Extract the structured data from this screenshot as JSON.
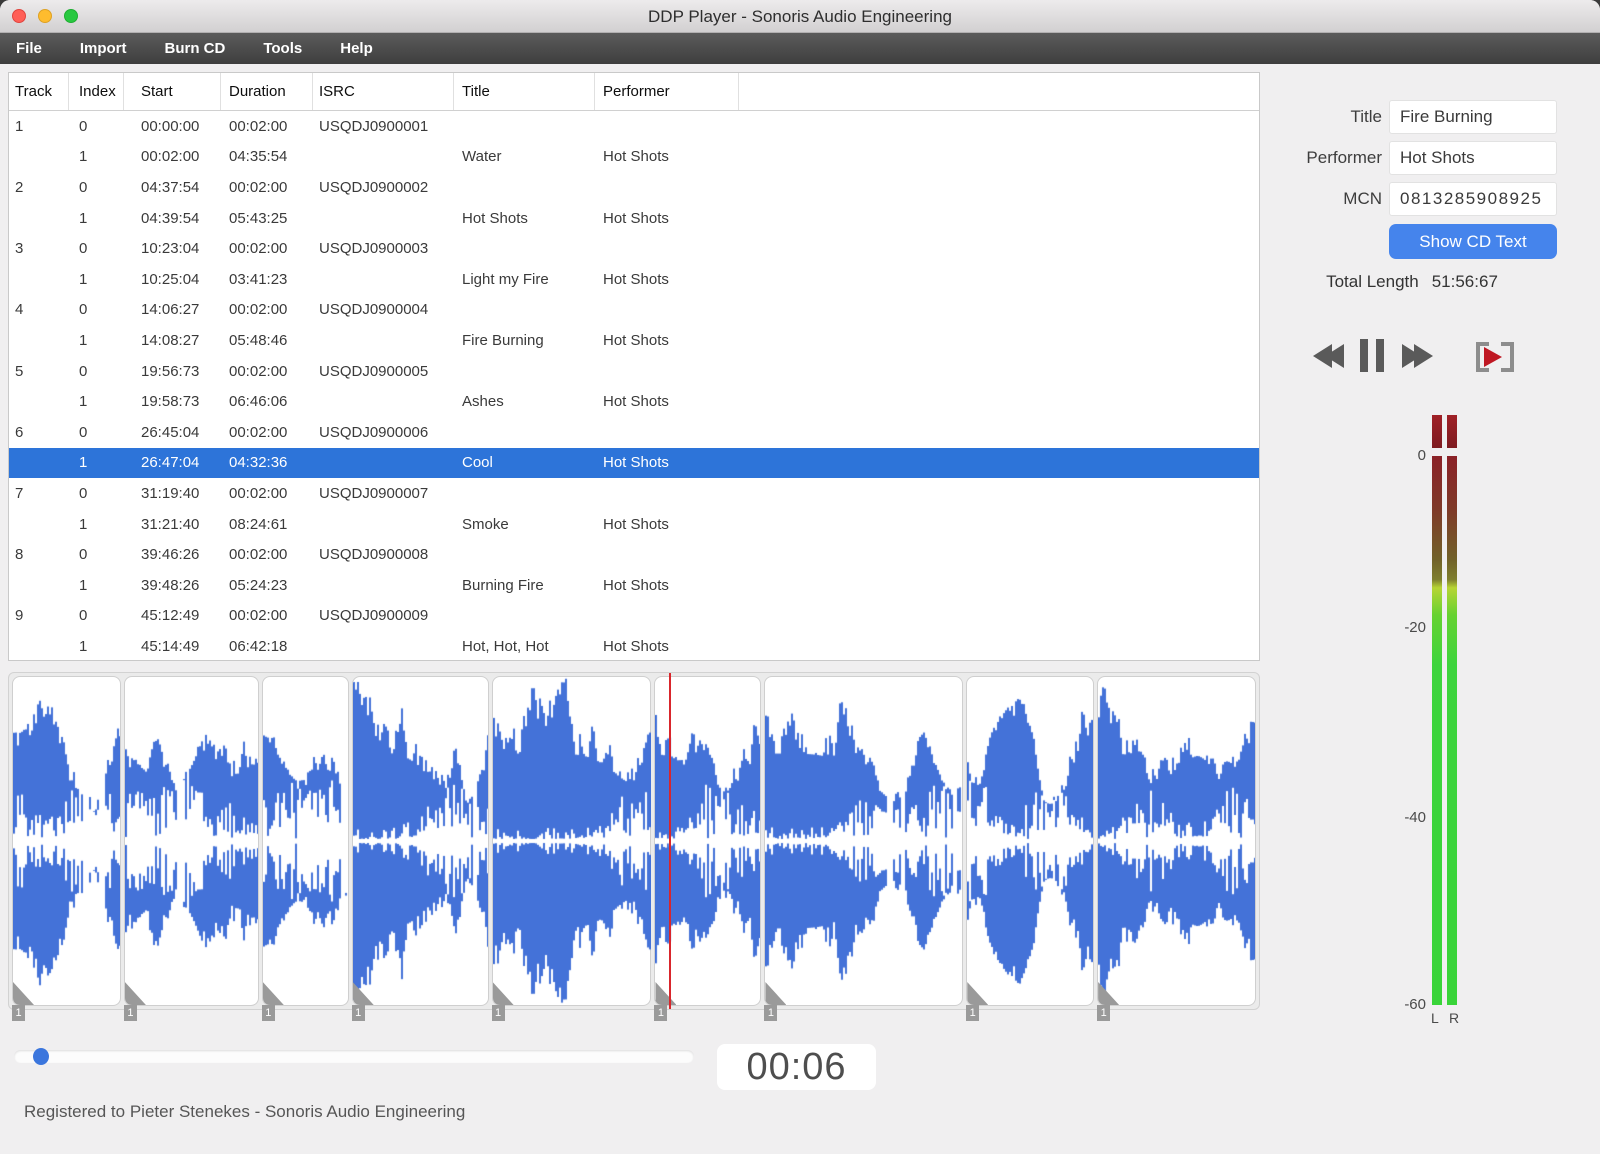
{
  "window": {
    "title": "DDP Player - Sonoris Audio Engineering"
  },
  "menu": {
    "items": [
      "File",
      "Import",
      "Burn CD",
      "Tools",
      "Help"
    ]
  },
  "table": {
    "columns": [
      "Track",
      "Index",
      "Start",
      "Duration",
      "ISRC",
      "Title",
      "Performer"
    ],
    "selected_index": 11,
    "rows": [
      {
        "track": "1",
        "index": "0",
        "start": "00:00:00",
        "duration": "00:02:00",
        "isrc": "USQDJ0900001",
        "title": "",
        "performer": ""
      },
      {
        "track": "",
        "index": "1",
        "start": "00:02:00",
        "duration": "04:35:54",
        "isrc": "",
        "title": "Water",
        "performer": "Hot Shots"
      },
      {
        "track": "2",
        "index": "0",
        "start": "04:37:54",
        "duration": "00:02:00",
        "isrc": "USQDJ0900002",
        "title": "",
        "performer": ""
      },
      {
        "track": "",
        "index": "1",
        "start": "04:39:54",
        "duration": "05:43:25",
        "isrc": "",
        "title": "Hot Shots",
        "performer": "Hot Shots"
      },
      {
        "track": "3",
        "index": "0",
        "start": "10:23:04",
        "duration": "00:02:00",
        "isrc": "USQDJ0900003",
        "title": "",
        "performer": ""
      },
      {
        "track": "",
        "index": "1",
        "start": "10:25:04",
        "duration": "03:41:23",
        "isrc": "",
        "title": "Light my Fire",
        "performer": "Hot Shots"
      },
      {
        "track": "4",
        "index": "0",
        "start": "14:06:27",
        "duration": "00:02:00",
        "isrc": "USQDJ0900004",
        "title": "",
        "performer": ""
      },
      {
        "track": "",
        "index": "1",
        "start": "14:08:27",
        "duration": "05:48:46",
        "isrc": "",
        "title": "Fire Burning",
        "performer": "Hot Shots"
      },
      {
        "track": "5",
        "index": "0",
        "start": "19:56:73",
        "duration": "00:02:00",
        "isrc": "USQDJ0900005",
        "title": "",
        "performer": ""
      },
      {
        "track": "",
        "index": "1",
        "start": "19:58:73",
        "duration": "06:46:06",
        "isrc": "",
        "title": "Ashes",
        "performer": "Hot Shots"
      },
      {
        "track": "6",
        "index": "0",
        "start": "26:45:04",
        "duration": "00:02:00",
        "isrc": "USQDJ0900006",
        "title": "",
        "performer": ""
      },
      {
        "track": "",
        "index": "1",
        "start": "26:47:04",
        "duration": "04:32:36",
        "isrc": "",
        "title": "Cool",
        "performer": "Hot Shots"
      },
      {
        "track": "7",
        "index": "0",
        "start": "31:19:40",
        "duration": "00:02:00",
        "isrc": "USQDJ0900007",
        "title": "",
        "performer": ""
      },
      {
        "track": "",
        "index": "1",
        "start": "31:21:40",
        "duration": "08:24:61",
        "isrc": "",
        "title": "Smoke",
        "performer": "Hot Shots"
      },
      {
        "track": "8",
        "index": "0",
        "start": "39:46:26",
        "duration": "00:02:00",
        "isrc": "USQDJ0900008",
        "title": "",
        "performer": ""
      },
      {
        "track": "",
        "index": "1",
        "start": "39:48:26",
        "duration": "05:24:23",
        "isrc": "",
        "title": "Burning Fire",
        "performer": "Hot Shots"
      },
      {
        "track": "9",
        "index": "0",
        "start": "45:12:49",
        "duration": "00:02:00",
        "isrc": "USQDJ0900009",
        "title": "",
        "performer": ""
      },
      {
        "track": "",
        "index": "1",
        "start": "45:14:49",
        "duration": "06:42:18",
        "isrc": "",
        "title": "Hot, Hot, Hot",
        "performer": "Hot Shots"
      }
    ]
  },
  "side_panel": {
    "title_label": "Title",
    "title_value": "Fire Burning",
    "performer_label": "Performer",
    "performer_value": "Hot Shots",
    "mcn_label": "MCN",
    "mcn_value": "0813285908925",
    "show_cd_text_label": "Show CD Text",
    "total_length_label": "Total Length",
    "total_length_value": "51:56:67"
  },
  "transport": {
    "icons": [
      "rewind-icon",
      "pause-icon",
      "fast-forward-icon",
      "pq-play-icon"
    ]
  },
  "meter": {
    "ticks": [
      "0",
      "-20",
      "-40",
      "-60"
    ],
    "channels": [
      "L",
      "R"
    ]
  },
  "waveform": {
    "marker_label": "1",
    "playhead_fraction": 0.527
  },
  "timeline": {
    "time_display": "00:06",
    "slider_fraction": 0.04
  },
  "status_bar": {
    "text": "Registered to Pieter Stenekes - Sonoris Audio Engineering"
  },
  "colors": {
    "selection_blue": "#2d74d9",
    "waveform_blue": "#4472d8",
    "button_blue": "#4584ec",
    "playhead_red": "#d9262c",
    "meter_green": "#3cd43c",
    "meter_yellow": "#b5d334",
    "meter_dark_red": "#8b2127",
    "traffic_red": "#ff5f57",
    "traffic_yellow": "#febc2e",
    "traffic_green": "#28c840"
  }
}
